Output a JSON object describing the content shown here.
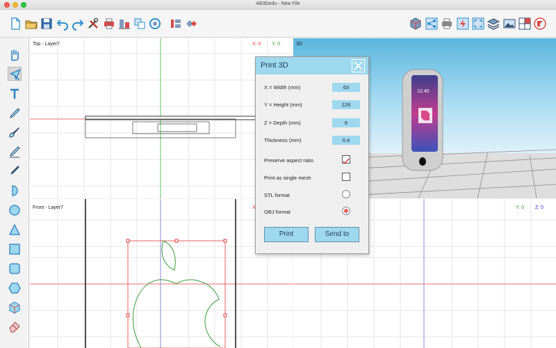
{
  "window": {
    "title": "AB3Dedu - New File"
  },
  "colors": {
    "accent": "#9ed8ef",
    "close_red": "#fc5f57",
    "minimize_yellow": "#fdbc2e",
    "zoom_green": "#28c840",
    "axis_red": "#e76f6f",
    "axis_green": "#5dc35d",
    "axis_blue": "#2727d6",
    "shape_green": "#3a9a3a",
    "selection_red": "#e03b3b"
  },
  "toolbar": {
    "left_icons": [
      "new-file-icon",
      "open-folder-icon",
      "save-icon",
      "undo-icon",
      "redo-icon",
      "tools-icon",
      "print-icon",
      "align-icon",
      "group-icon",
      "rotate-icon",
      "mirror-icon",
      "erase-icon"
    ],
    "right_icons": [
      "cube-view-icon",
      "share-icon",
      "printer-icon",
      "energy-icon",
      "fit-view-icon",
      "layers-icon",
      "image-icon",
      "split-view-icon",
      "logo-icon"
    ]
  },
  "left_tools": [
    "hand-icon",
    "pointer-icon",
    "text-icon",
    "pen-icon",
    "brush-icon",
    "pencil-icon",
    "marker-icon",
    "half-circle-icon",
    "circle-icon",
    "triangle-icon",
    "square-icon",
    "rounded-square-icon",
    "hexagon-icon",
    "object-icon",
    "eraser-icon"
  ],
  "views": {
    "top": {
      "label": "Top - Layer7",
      "x_coord": "X: 0",
      "y_coord": "Y: 0"
    },
    "front": {
      "label": "Front - Layer7",
      "x_coord": "X",
      "y_coord": "Y: 0",
      "z_coord": "Z: 0"
    },
    "view3d": {
      "label": "3D",
      "phone_time": "12:40"
    }
  },
  "dialog": {
    "title": "Print 3D",
    "fields": [
      {
        "label": "X = Width (mm)",
        "value": "63"
      },
      {
        "label": "Y = Height (mm)",
        "value": "126"
      },
      {
        "label": "Z = Depth (mm)",
        "value": "6"
      },
      {
        "label": "Thickness (mm)",
        "value": "0.4"
      }
    ],
    "options": [
      {
        "label": "Preserve aspect ratio",
        "checked": true
      },
      {
        "label": "Print as single mesh",
        "checked": false
      }
    ],
    "formats": [
      {
        "label": "STL format",
        "selected": false
      },
      {
        "label": "OBJ format",
        "selected": true
      }
    ],
    "print_label": "Print",
    "send_label": "Send to"
  }
}
